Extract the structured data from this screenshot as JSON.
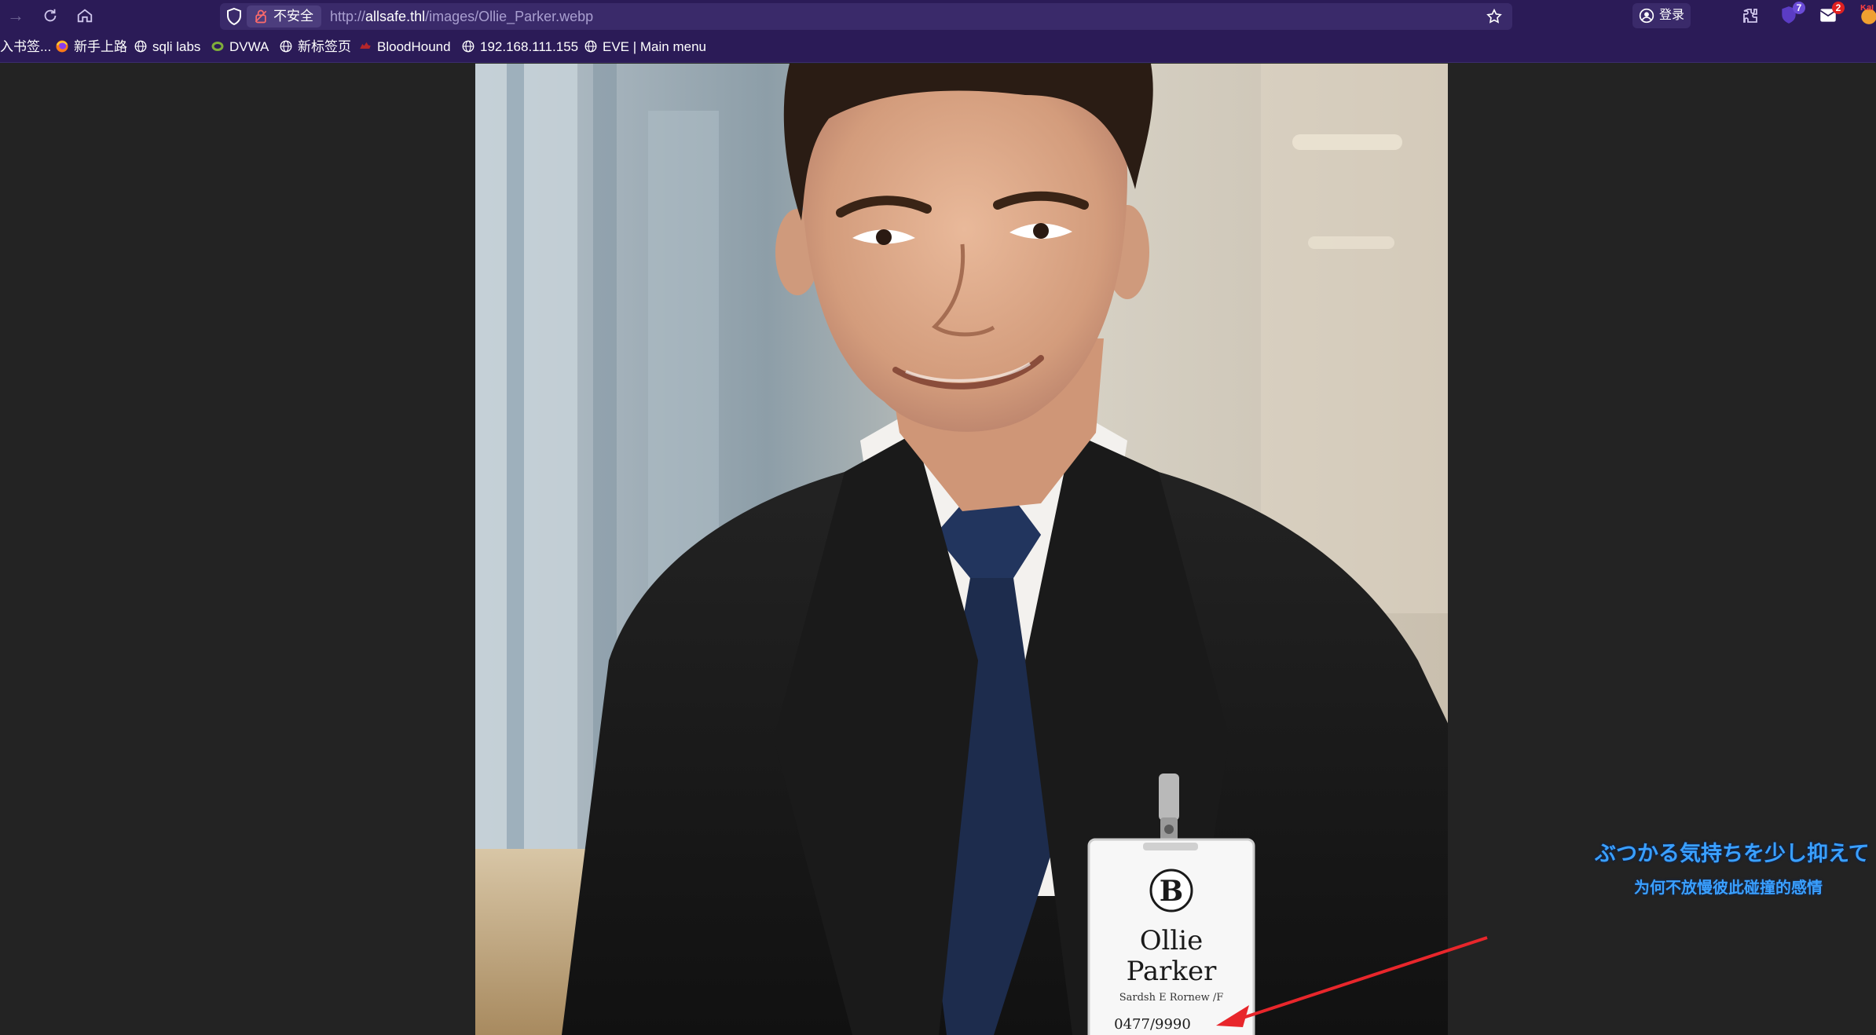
{
  "browser": {
    "security_label": "不安全",
    "url_prefix": "http://",
    "url_host": "allsafe.thl",
    "url_path": "/images/Ollie_Parker.webp",
    "account_label": "登录",
    "extension_badges": [
      "7",
      "2"
    ],
    "truncated_profile_label": "Kal"
  },
  "bookmarks": [
    {
      "label": "入书签...",
      "icon": "none"
    },
    {
      "label": "新手上路",
      "icon": "firefox-icon"
    },
    {
      "label": "sqli labs",
      "icon": "globe-icon"
    },
    {
      "label": "DVWA",
      "icon": "dvwa-icon"
    },
    {
      "label": "新标签页",
      "icon": "globe-icon"
    },
    {
      "label": "BloodHound",
      "icon": "bloodhound-icon"
    },
    {
      "label": "192.168.111.155",
      "icon": "globe-icon"
    },
    {
      "label": "EVE | Main menu",
      "icon": "globe-icon"
    }
  ],
  "badge": {
    "logo_letter": "B",
    "first_name": "Ollie",
    "last_name": "Parker",
    "title_line": "Sardsh E Rornew /F",
    "number": "0477/9990"
  },
  "overlay": {
    "japanese_line": "ぶつかる気持ちを少し抑えて",
    "chinese_line": "为何不放慢彼此碰撞的感情"
  },
  "colors": {
    "toolbar": "#2b1b57",
    "urlbar": "#3a2a6a",
    "page_bg": "#232323",
    "arrow": "#e8262b",
    "overlay_text": "#3aa0ff"
  }
}
